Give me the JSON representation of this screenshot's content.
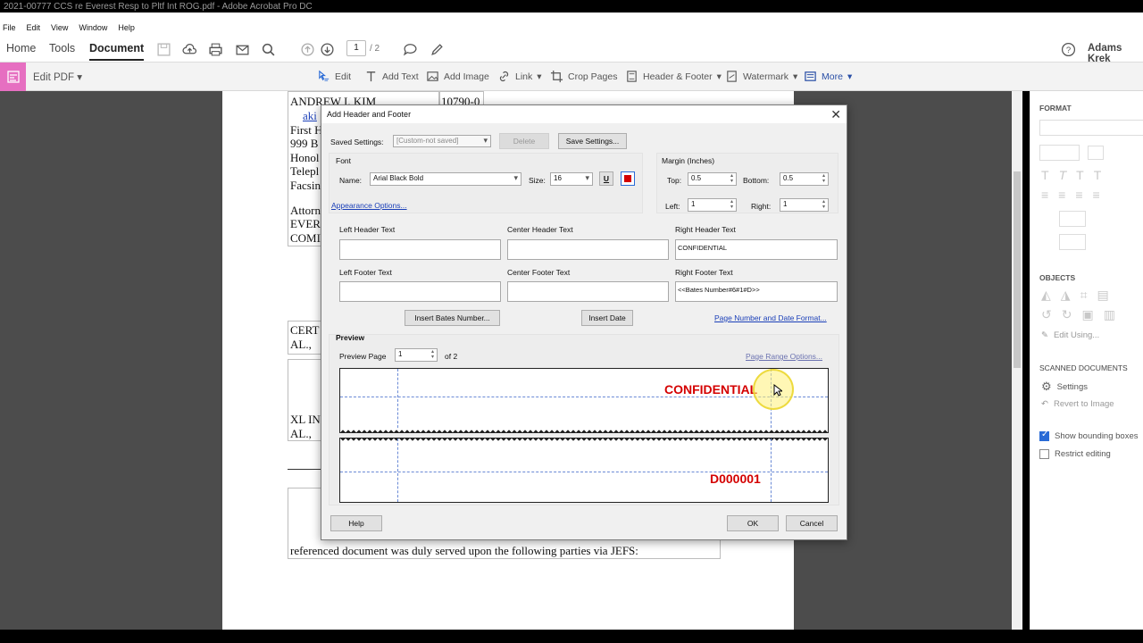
{
  "window": {
    "title": "2021-00777 CCS re Everest Resp to Pltf Int ROG.pdf - Adobe Acrobat Pro DC"
  },
  "menu": [
    "File",
    "Edit",
    "View",
    "Window",
    "Help"
  ],
  "toolbar": {
    "tabs": [
      "Home",
      "Tools",
      "Document"
    ],
    "page_current": "1",
    "page_total": "/ 2",
    "user": "Adams Krek"
  },
  "editbar": {
    "title": "Edit PDF",
    "items": [
      "Edit",
      "Add Text",
      "Add Image",
      "Link",
      "Crop Pages",
      "Header & Footer",
      "Watermark",
      "More"
    ]
  },
  "document": {
    "lines": [
      "ANDREW I. KIM",
      "aki",
      "First H",
      "999 B",
      "Honol",
      "Telepl",
      "Facsin",
      "Attorn",
      "EVER",
      "COMI",
      "10790-0",
      "CERT",
      "AL.,",
      "XL IN",
      "AL.,",
      "referenced document was duly served upon the following parties via JEFS:"
    ]
  },
  "rightpanel": {
    "format_heading": "FORMAT",
    "objects_heading": "OBJECTS",
    "edit_using": "Edit Using...",
    "scanned_heading": "SCANNED DOCUMENTS",
    "settings": "Settings",
    "revert": "Revert to Image",
    "show_bounding": "Show bounding boxes",
    "restrict": "Restrict editing"
  },
  "dialog": {
    "title": "Add Header and Footer",
    "saved_settings_label": "Saved Settings:",
    "saved_settings_value": "[Custom-not saved]",
    "delete_label": "Delete",
    "save_settings_label": "Save Settings...",
    "font_group": "Font",
    "name_label": "Name:",
    "font_name": "Arial Black Bold",
    "size_label": "Size:",
    "font_size": "16",
    "underline_label": "U",
    "appearance_link": "Appearance Options...",
    "margin_group": "Margin (Inches)",
    "top_label": "Top:",
    "top_value": "0.5",
    "bottom_label": "Bottom:",
    "bottom_value": "0.5",
    "left_label": "Left:",
    "left_value": "1",
    "right_label": "Right:",
    "right_value": "1",
    "left_header_label": "Left Header Text",
    "center_header_label": "Center Header Text",
    "right_header_label": "Right Header Text",
    "left_header_value": "",
    "center_header_value": "",
    "right_header_value": "CONFIDENTIAL",
    "left_footer_label": "Left Footer Text",
    "center_footer_label": "Center Footer Text",
    "right_footer_label": "Right Footer Text",
    "left_footer_value": "",
    "center_footer_value": "",
    "right_footer_value": "<<Bates Number#6#1#D>>",
    "insert_bates_label": "Insert Bates Number...",
    "insert_date_label": "Insert Date",
    "page_number_link": "Page Number and Date Format...",
    "preview_group": "Preview",
    "preview_page_label": "Preview Page",
    "preview_page_value": "1",
    "preview_of": "of 2",
    "page_range_link": "Page Range Options...",
    "preview_header_text": "CONFIDENTIAL",
    "preview_footer_text": "D000001",
    "help_label": "Help",
    "ok_label": "OK",
    "cancel_label": "Cancel",
    "accent_color": "#d40000"
  }
}
